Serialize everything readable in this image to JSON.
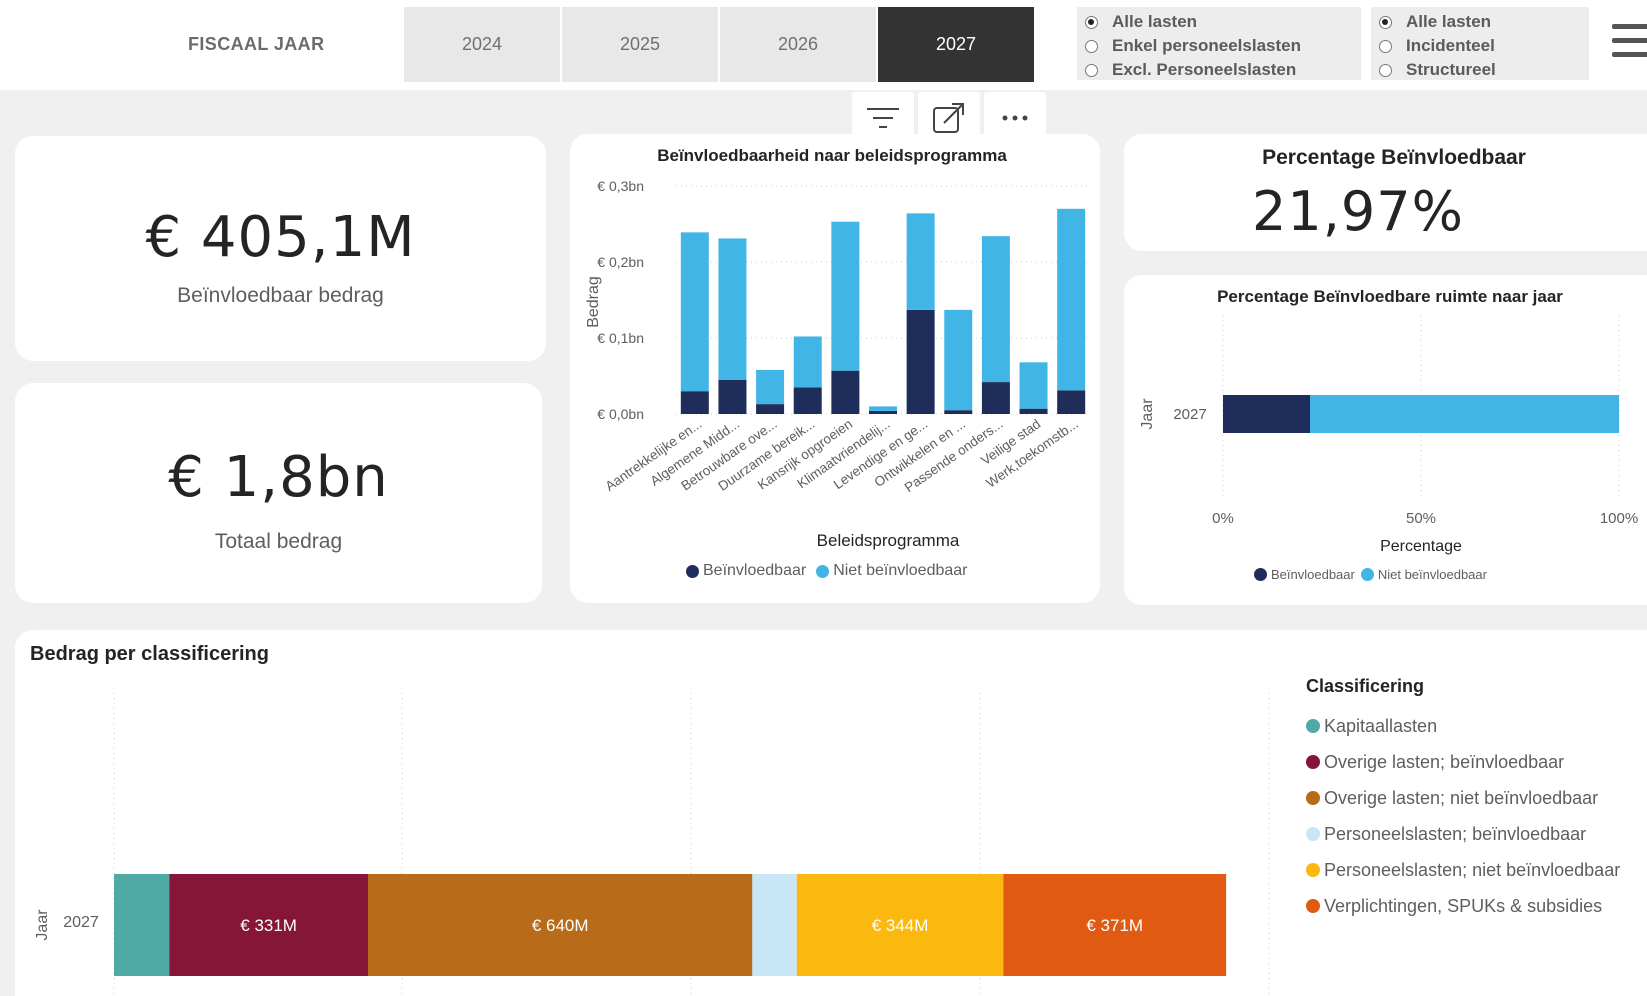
{
  "header": {
    "fiscal_label": "FISCAAL JAAR",
    "years": [
      "2024",
      "2025",
      "2026",
      "2027"
    ],
    "active_year": "2027",
    "filter1": [
      {
        "label": "Alle lasten",
        "checked": true
      },
      {
        "label": "Enkel personeelslasten",
        "checked": false
      },
      {
        "label": "Excl. Personeelslasten",
        "checked": false
      }
    ],
    "filter2": [
      {
        "label": "Alle lasten",
        "checked": true
      },
      {
        "label": "Incidenteel",
        "checked": false
      },
      {
        "label": "Structureel",
        "checked": false
      }
    ]
  },
  "kpis": {
    "influenceable_value": "€ 405,1M",
    "influenceable_label": "Beïnvloedbaar bedrag",
    "total_value": "€ 1,8bn",
    "total_label": "Totaal bedrag",
    "percentage_title": "Percentage Beïnvloedbaar",
    "percentage_value": "21,97%"
  },
  "colors": {
    "dark_navy": "#1f2d5a",
    "light_blue": "#41b6e6",
    "kapitaal": "#4fa9a4",
    "overige_beinvl": "#851637",
    "overige_niet": "#b86b19",
    "personeel_beinvl": "#c9e6f6",
    "personeel_niet": "#fbb90f",
    "verplichtingen": "#e05a12"
  },
  "chart_data": [
    {
      "type": "bar",
      "stacked": true,
      "title": "Beïnvloedbaarheid naar beleidsprogramma",
      "xlabel": "Beleidsprogramma",
      "ylabel": "Bedrag",
      "ylim": [
        0,
        0.3
      ],
      "y_ticks": [
        "€ 0,0bn",
        "€ 0,1bn",
        "€ 0,2bn",
        "€ 0,3bn"
      ],
      "grid": true,
      "legend_position": "bottom",
      "categories": [
        "Aantrekkelijke en...",
        "Algemene Midd...",
        "Betrouwbare ove...",
        "Duurzame bereik...",
        "Kansrijk opgroeien",
        "Klimaatvriendelij...",
        "Levendige en ge...",
        "Ontwikkelen en ...",
        "Passende onders...",
        "Veilige stad",
        "Werk,toekomstb..."
      ],
      "series": [
        {
          "name": "Beïnvloedbaar",
          "values": [
            0.03,
            0.045,
            0.013,
            0.035,
            0.057,
            0.004,
            0.137,
            0.005,
            0.042,
            0.007,
            0.031
          ]
        },
        {
          "name": "Niet beïnvloedbaar",
          "values": [
            0.209,
            0.186,
            0.045,
            0.067,
            0.196,
            0.006,
            0.127,
            0.132,
            0.192,
            0.061,
            0.239
          ]
        }
      ]
    },
    {
      "type": "bar",
      "orientation": "horizontal",
      "stacked": true,
      "title": "Percentage Beïnvloedbare ruimte naar jaar",
      "xlabel": "Percentage",
      "ylabel": "Jaar",
      "xlim": [
        0,
        100
      ],
      "x_ticks": [
        "0%",
        "50%",
        "100%"
      ],
      "grid": true,
      "legend_position": "bottom",
      "categories": [
        "2027"
      ],
      "series": [
        {
          "name": "Beïnvloedbaar",
          "values": [
            21.97
          ]
        },
        {
          "name": "Niet beïnvloedbaar",
          "values": [
            78.03
          ]
        }
      ]
    },
    {
      "type": "bar",
      "orientation": "horizontal",
      "stacked": true,
      "title": "Bedrag per classificering",
      "ylabel": "Jaar",
      "legend_title": "Classificering",
      "legend_position": "right",
      "grid": true,
      "categories": [
        "2027"
      ],
      "series": [
        {
          "name": "Kapitaallasten",
          "values": [
            92
          ],
          "label": ""
        },
        {
          "name": "Overige lasten; beïnvloedbaar",
          "values": [
            331
          ],
          "label": "€ 331M"
        },
        {
          "name": "Overige lasten; niet beïnvloedbaar",
          "values": [
            640
          ],
          "label": "€ 640M"
        },
        {
          "name": "Personeelslasten; beïnvloedbaar",
          "values": [
            74
          ],
          "label": ""
        },
        {
          "name": "Personeelslasten; niet beïnvloedbaar",
          "values": [
            344
          ],
          "label": "€ 344M"
        },
        {
          "name": "Verplichtingen, SPUKs & subsidies",
          "values": [
            371
          ],
          "label": "€ 371M"
        }
      ]
    }
  ]
}
